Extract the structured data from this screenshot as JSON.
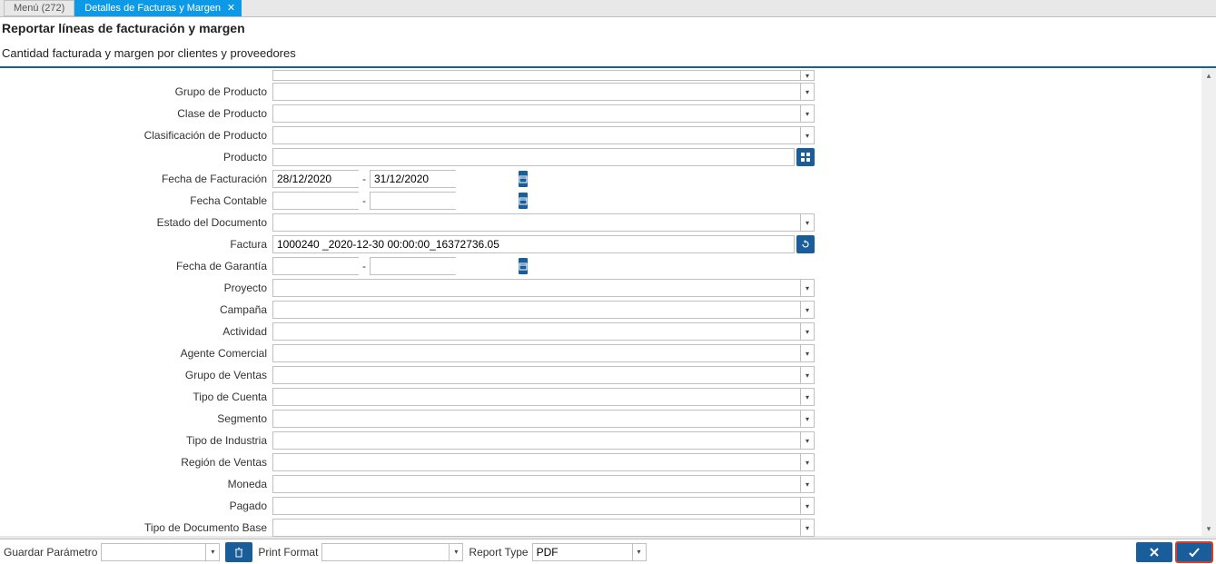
{
  "tabs": {
    "menu": "Menú (272)",
    "active": "Detalles de Facturas y Margen"
  },
  "header": {
    "title": "Reportar líneas de facturación y margen",
    "subtitle": "Cantidad facturada y margen por clientes y proveedores"
  },
  "fields": {
    "grupo_producto": {
      "label": "Grupo de Producto",
      "value": ""
    },
    "clase_producto": {
      "label": "Clase de Producto",
      "value": ""
    },
    "clasificacion_producto": {
      "label": "Clasificación de Producto",
      "value": ""
    },
    "producto": {
      "label": "Producto",
      "value": ""
    },
    "fecha_facturacion": {
      "label": "Fecha de Facturación",
      "from": "28/12/2020",
      "to": "31/12/2020"
    },
    "fecha_contable": {
      "label": "Fecha Contable",
      "from": "",
      "to": ""
    },
    "estado_documento": {
      "label": "Estado del Documento",
      "value": ""
    },
    "factura": {
      "label": "Factura",
      "value": "1000240 _2020-12-30 00:00:00_16372736.05"
    },
    "fecha_garantia": {
      "label": "Fecha de Garantía",
      "from": "",
      "to": ""
    },
    "proyecto": {
      "label": "Proyecto",
      "value": ""
    },
    "campana": {
      "label": "Campaña",
      "value": ""
    },
    "actividad": {
      "label": "Actividad",
      "value": ""
    },
    "agente_comercial": {
      "label": "Agente Comercial",
      "value": ""
    },
    "grupo_ventas": {
      "label": "Grupo de Ventas",
      "value": ""
    },
    "tipo_cuenta": {
      "label": "Tipo de Cuenta",
      "value": ""
    },
    "segmento": {
      "label": "Segmento",
      "value": ""
    },
    "tipo_industria": {
      "label": "Tipo de Industria",
      "value": ""
    },
    "region_ventas": {
      "label": "Región de Ventas",
      "value": ""
    },
    "moneda": {
      "label": "Moneda",
      "value": ""
    },
    "pagado": {
      "label": "Pagado",
      "value": ""
    },
    "tipo_documento_base": {
      "label": "Tipo de Documento Base",
      "value": ""
    }
  },
  "bottom": {
    "guardar_parametro": "Guardar Parámetro",
    "guardar_parametro_value": "",
    "print_format": "Print Format",
    "print_format_value": "",
    "report_type": "Report Type",
    "report_type_value": "PDF"
  }
}
